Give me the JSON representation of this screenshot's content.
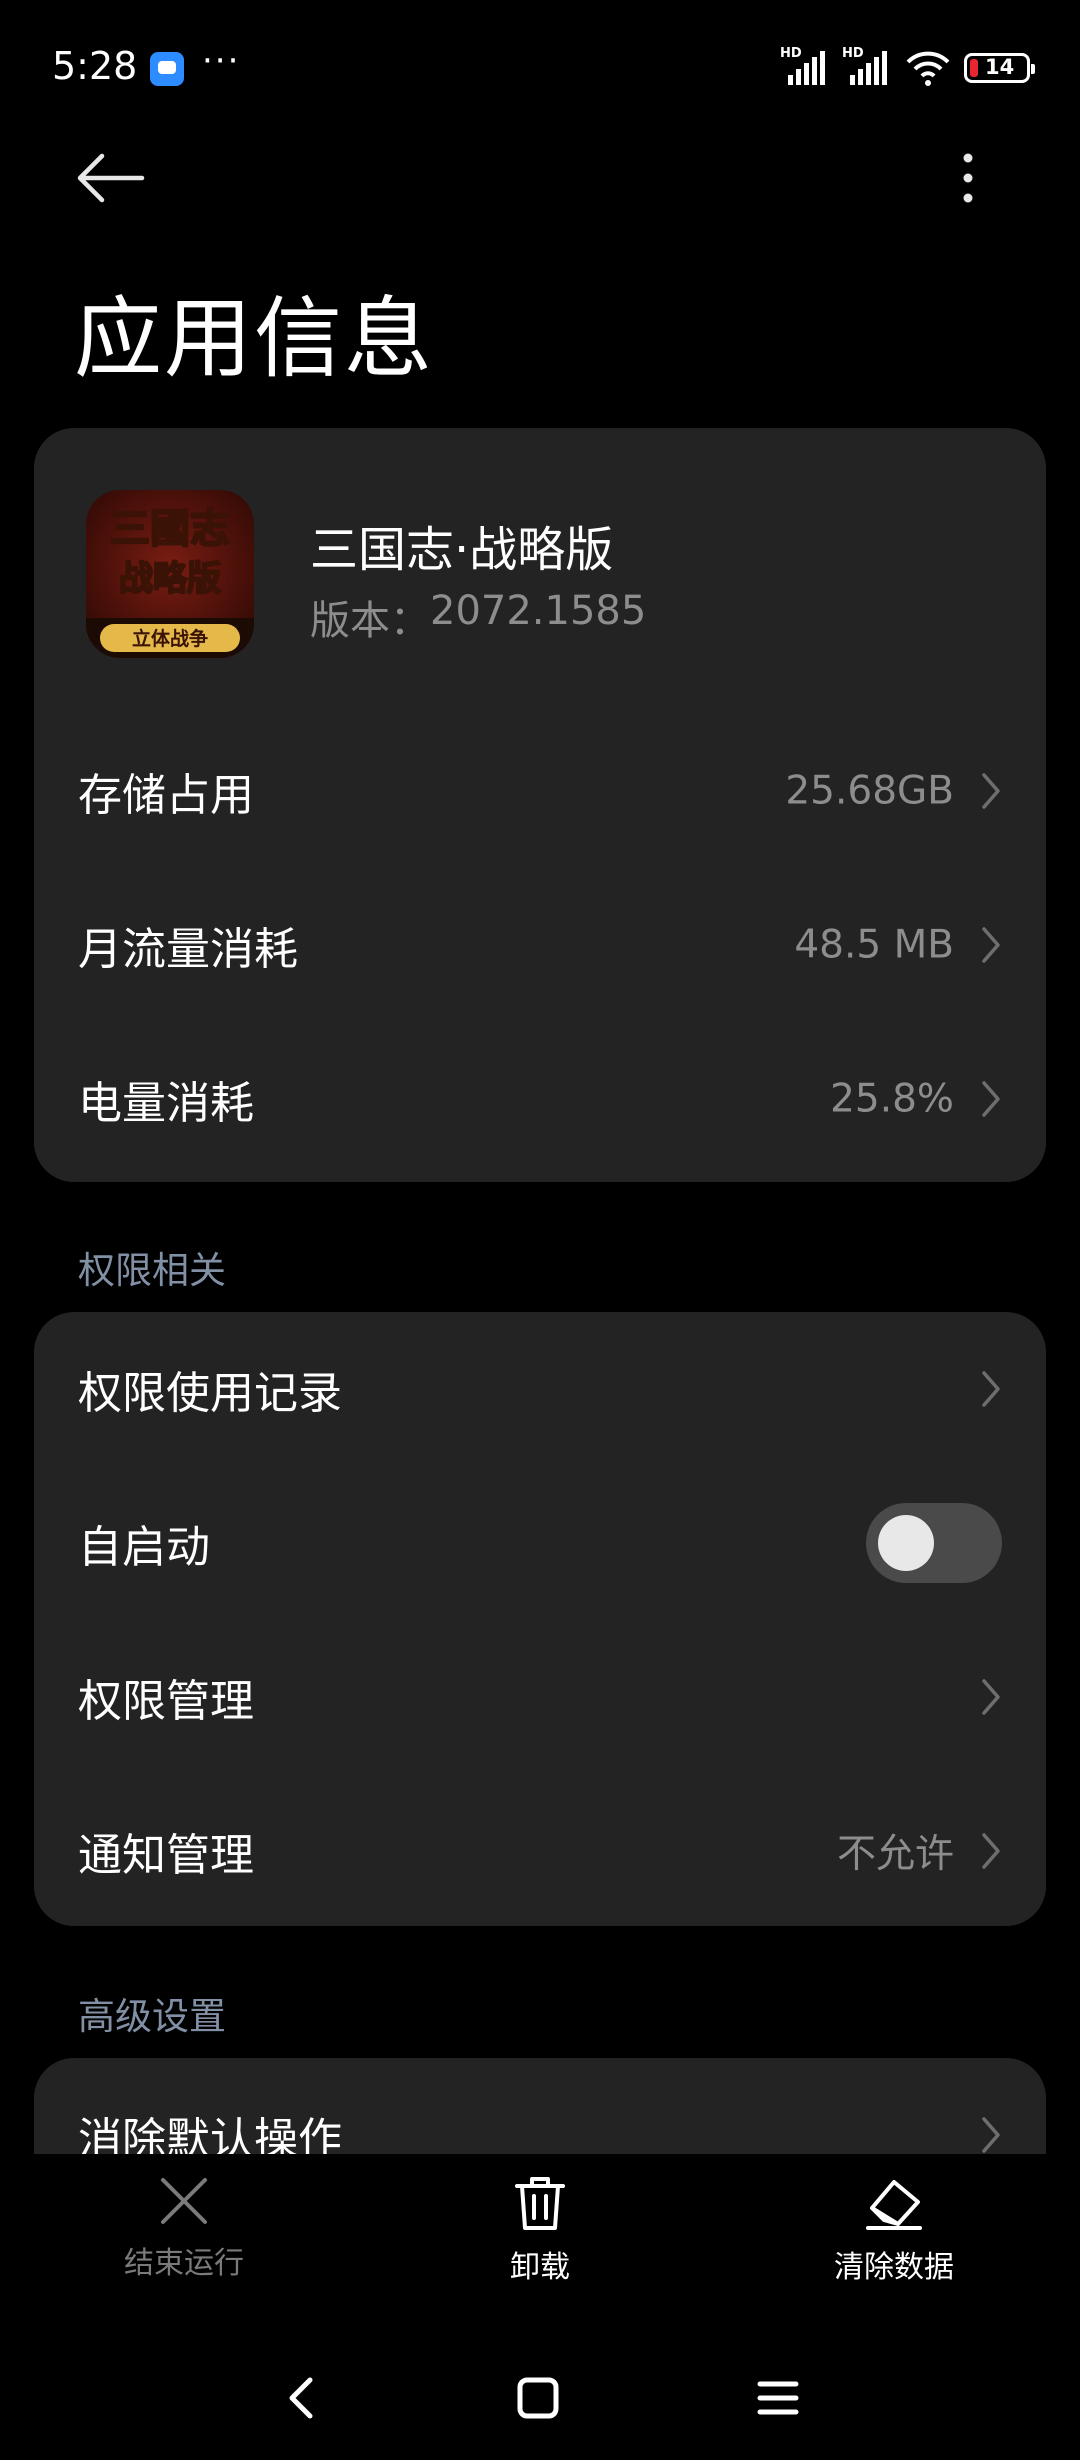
{
  "status_bar": {
    "time": "5:28",
    "battery_level": "14",
    "signal_label": "HD",
    "battery_color": "#e9262f"
  },
  "header": {
    "title": "应用信息"
  },
  "app": {
    "name": "三国志·战略版",
    "version_label": "版本：",
    "version": "2072.1585",
    "icon_text_top": "三國志",
    "icon_text_mid": "战略版",
    "icon_text_bottom": "立体战争"
  },
  "usage": [
    {
      "label": "存储占用",
      "value": "25.68GB"
    },
    {
      "label": "月流量消耗",
      "value": "48.5 MB"
    },
    {
      "label": "电量消耗",
      "value": "25.8%"
    }
  ],
  "permissions_section": {
    "header": "权限相关",
    "items": [
      {
        "label": "权限使用记录",
        "value": ""
      },
      {
        "label": "自启动",
        "toggle": false
      },
      {
        "label": "权限管理",
        "value": ""
      },
      {
        "label": "通知管理",
        "value": "不允许"
      }
    ]
  },
  "advanced_section": {
    "header": "高级设置",
    "items": [
      {
        "label": "消除默认操作"
      }
    ]
  },
  "actions": {
    "force_stop": "结束运行",
    "uninstall": "卸载",
    "clear_data": "清除数据"
  },
  "colors": {
    "background": "#000000",
    "card": "#232323",
    "section_header": "#8290a6",
    "secondary_text": "#8d8d8d"
  }
}
